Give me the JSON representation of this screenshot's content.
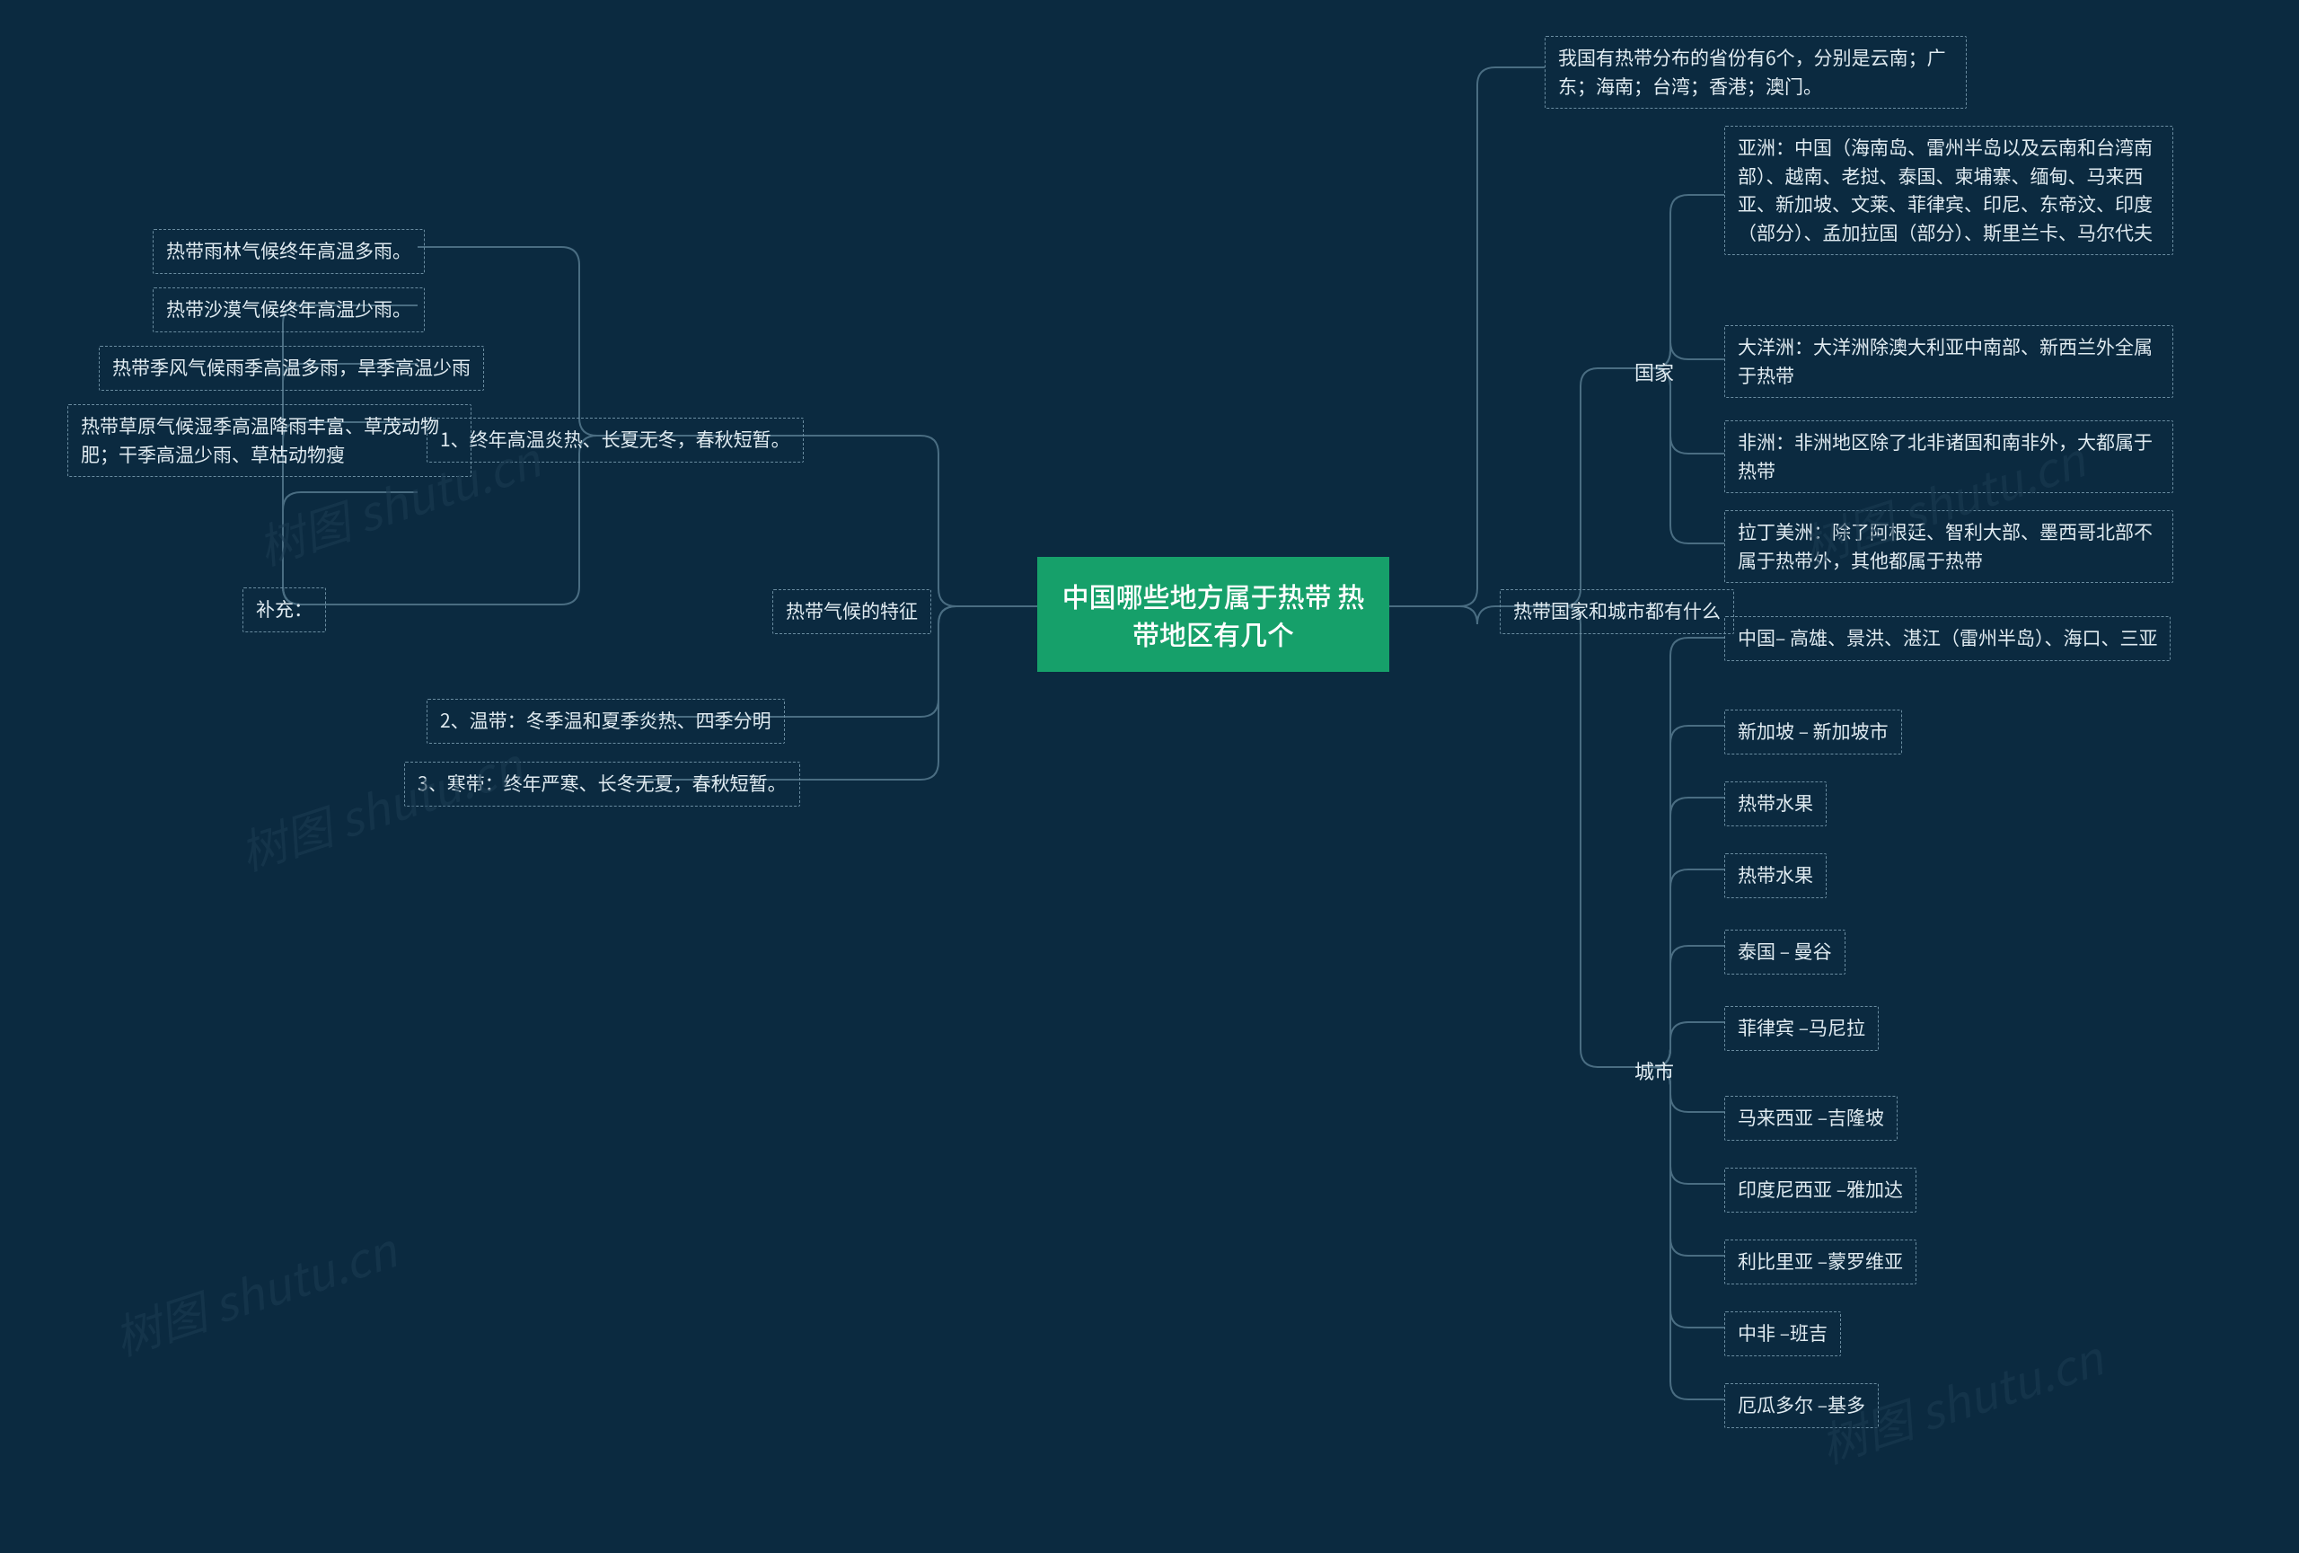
{
  "center": "中国哪些地方属于热带 热带地区有几个",
  "left": {
    "title": "热带气候的特征",
    "items": [
      "1、终年高温炎热、长夏无冬，春秋短暂。",
      "2、温带：冬季温和夏季炎热、四季分明",
      "3、寒带：终年严寒、长冬无夏，春秋短暂。"
    ],
    "supplement_label": "补充：",
    "supplement": [
      "热带雨林气候终年高温多雨。",
      "热带沙漠气候终年高温少雨。",
      "热带季风气候雨季高温多雨，旱季高温少雨",
      "热带草原气候湿季高温降雨丰富、草茂动物肥；干季高温少雨、草枯动物瘦"
    ]
  },
  "right": {
    "title": "热带国家和城市都有什么",
    "provinces": "我国有热带分布的省份有6个，分别是云南；广东；海南；台湾；香港；澳门。",
    "countries_label": "国家",
    "countries": [
      "亚洲：中国（海南岛、雷州半岛以及云南和台湾南部）、越南、老挝、泰国、柬埔寨、缅甸、马来西亚、新加坡、文莱、菲律宾、印尼、东帝汶、印度（部分）、孟加拉国（部分）、斯里兰卡、马尔代夫",
      "大洋洲：大洋洲除澳大利亚中南部、新西兰外全属于热带",
      "非洲：非洲地区除了北非诸国和南非外，大都属于热带",
      "拉丁美洲：除了阿根廷、智利大部、墨西哥北部不属于热带外，其他都属于热带"
    ],
    "cities_label": "城市",
    "cities": [
      "中国– 高雄、景洪、湛江（雷州半岛）、海口、三亚",
      "新加坡 – 新加坡市",
      "热带水果",
      "热带水果",
      "泰国 – 曼谷",
      "菲律宾 –马尼拉",
      "马来西亚 –吉隆坡",
      "印度尼西亚 –雅加达",
      "利比里亚 –蒙罗维亚",
      "中非 –班吉",
      "厄瓜多尔 –基多"
    ]
  },
  "watermark": "树图 shutu.cn"
}
